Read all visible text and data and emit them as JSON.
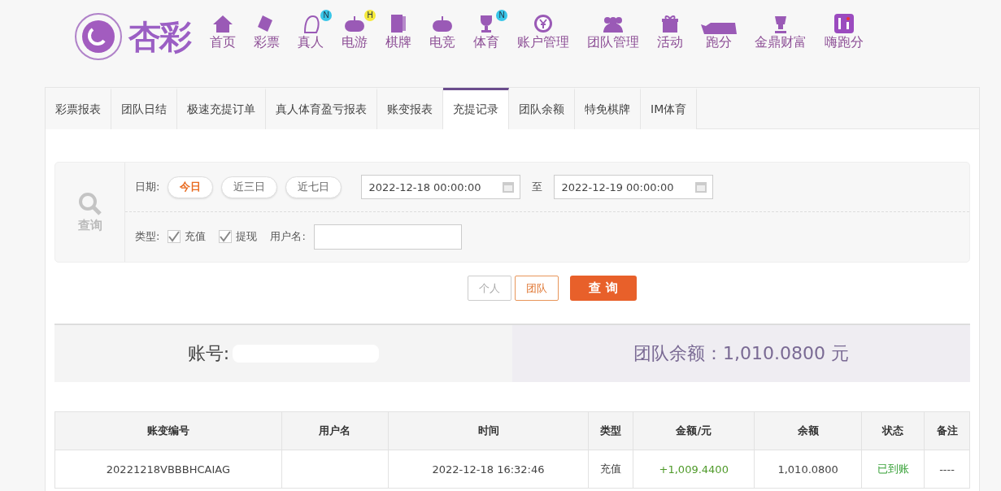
{
  "brand": {
    "name": "杏彩"
  },
  "nav": [
    {
      "label": "首页"
    },
    {
      "label": "彩票"
    },
    {
      "label": "真人",
      "badge": {
        "text": "N",
        "color": "#38c6e8"
      }
    },
    {
      "label": "电游",
      "badge": {
        "text": "H",
        "color": "#f5e93a"
      }
    },
    {
      "label": "棋牌"
    },
    {
      "label": "电竞"
    },
    {
      "label": "体育",
      "badge": {
        "text": "N",
        "color": "#38c6e8"
      }
    },
    {
      "label": "账户管理"
    },
    {
      "label": "团队管理"
    },
    {
      "label": "活动"
    },
    {
      "label": "跑分"
    },
    {
      "label": "金鼎财富"
    },
    {
      "label": "嗨跑分"
    }
  ],
  "tabs": [
    {
      "label": "彩票报表",
      "selected": false
    },
    {
      "label": "团队日结",
      "selected": false
    },
    {
      "label": "极速充提订单",
      "selected": false
    },
    {
      "label": "真人体育盈亏报表",
      "selected": false
    },
    {
      "label": "账变报表",
      "selected": false
    },
    {
      "label": "充提记录",
      "selected": true
    },
    {
      "label": "团队余额",
      "selected": false
    },
    {
      "label": "特免棋牌",
      "selected": false
    },
    {
      "label": "IM体育",
      "selected": false
    }
  ],
  "filter": {
    "side_label": "查询",
    "date_label": "日期:",
    "ranges": [
      {
        "label": "今日",
        "selected": true
      },
      {
        "label": "近三日",
        "selected": false
      },
      {
        "label": "近七日",
        "selected": false
      }
    ],
    "start": "2022-12-18 00:00:00",
    "to": "至",
    "end": "2022-12-19 00:00:00",
    "type_label": "类型:",
    "types": [
      {
        "label": "充值",
        "checked": true
      },
      {
        "label": "提现",
        "checked": true
      }
    ],
    "username_label": "用户名:",
    "scopes": [
      {
        "label": "个人",
        "selected": false
      },
      {
        "label": "团队",
        "selected": true
      }
    ],
    "submit": "查 询"
  },
  "summary": {
    "account_label": "账号:",
    "balance": "团队余额：1,010.0800 元"
  },
  "table": {
    "columns": [
      "账变编号",
      "用户名",
      "时间",
      "类型",
      "金额/元",
      "余额",
      "状态",
      "备注"
    ],
    "rows": [
      {
        "id": "20221218VBBBHCAIAG",
        "time": "2022-12-18 16:32:46",
        "type": "充值",
        "amount": "+1,009.4400",
        "balance": "1,010.0800",
        "status": "已到账",
        "note": "----"
      }
    ]
  }
}
